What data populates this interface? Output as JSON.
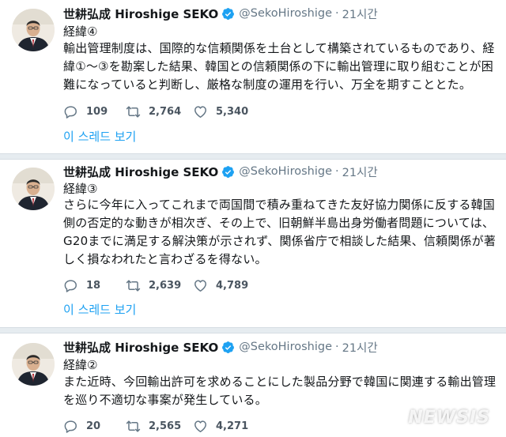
{
  "tweets": [
    {
      "name": "世耕弘成 Hiroshige SEKO",
      "handle": "@SekoHiroshige",
      "separator": "·",
      "time": "21시간",
      "label": "経緯④",
      "lines": [
        "輸出管理制度は、国際的な信頼関係を土台として構築されているものであり、経",
        "緯①～③を勘案した結果、韓国との信頼関係の下に輸出管理に取り組むことが困",
        "難になっていると判断し、厳格な制度の運用を行い、万全を期すこととた。"
      ],
      "replies": "109",
      "retweets": "2,764",
      "likes": "5,340",
      "thread_link": "이 스레드 보기"
    },
    {
      "name": "世耕弘成 Hiroshige SEKO",
      "handle": "@SekoHiroshige",
      "separator": "·",
      "time": "21시간",
      "label": "経緯③",
      "lines": [
        "さらに今年に入ってこれまで両国間で積み重ねてきた友好協力関係に反する韓国",
        "側の否定的な動きが相次ぎ、その上で、旧朝鮮半島出身労働者問題については、",
        "G20までに満足する解決策が示されず、関係省庁で相談した結果、信頼関係が著",
        "しく損なわれたと言わざるを得ない。"
      ],
      "replies": "18",
      "retweets": "2,639",
      "likes": "4,789",
      "thread_link": "이 스레드 보기"
    },
    {
      "name": "世耕弘成 Hiroshige SEKO",
      "handle": "@SekoHiroshige",
      "separator": "·",
      "time": "21시간",
      "label": "経緯②",
      "lines": [
        "また近時、今回輸出許可を求めることにした製品分野で韓国に関連する輸出管理",
        "を巡り不適切な事案が発生している。"
      ],
      "replies": "20",
      "retweets": "2,565",
      "likes": "4,271"
    }
  ],
  "watermark": "NEWSIS",
  "colors": {
    "link": "#1da1f2",
    "secondary": "#657786",
    "separator": "#e6ecf0"
  }
}
